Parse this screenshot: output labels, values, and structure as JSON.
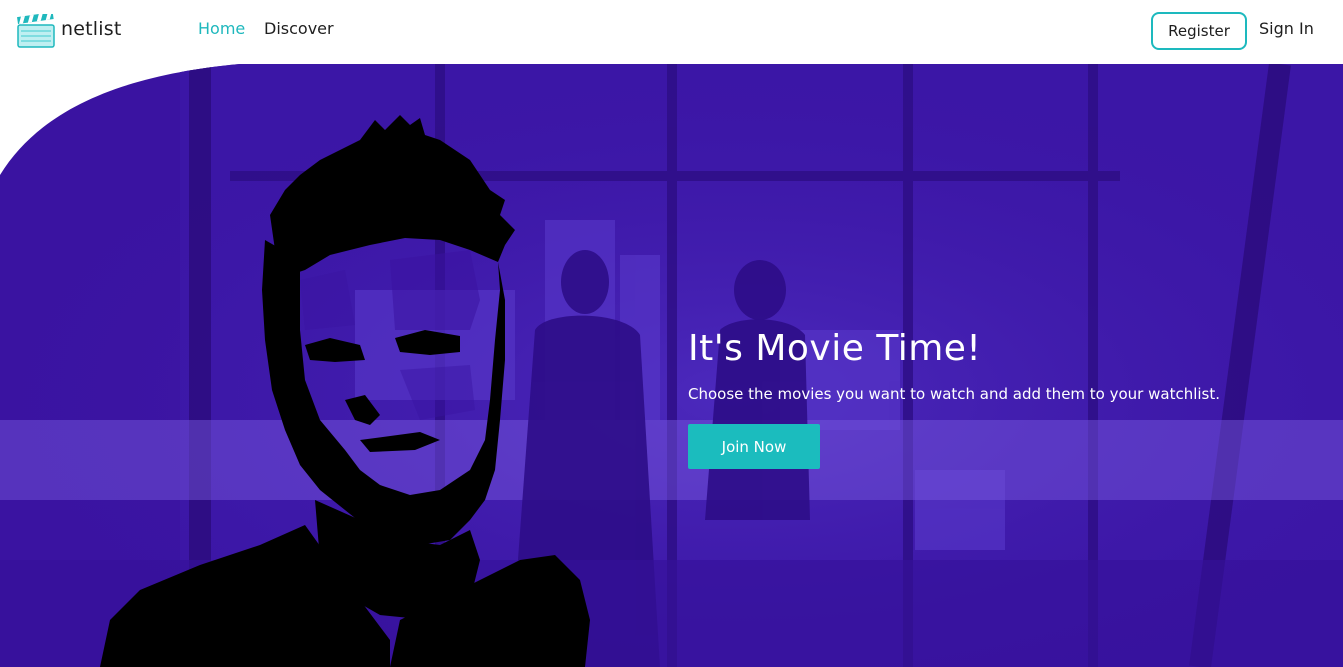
{
  "brand": {
    "name": "netlist",
    "logo_icon": "clapperboard-icon"
  },
  "nav": {
    "home": "Home",
    "discover": "Discover",
    "register": "Register",
    "sign_in": "Sign In",
    "active_item": "Home"
  },
  "hero": {
    "title": "It's Movie Time!",
    "subtitle": "Choose the movies you want to watch and add them to your watchlist.",
    "cta": "Join Now"
  },
  "colors": {
    "accent": "#1db9be",
    "hero_purple": "#3a12a0",
    "text_dark": "#1e1e1e",
    "white": "#ffffff"
  }
}
